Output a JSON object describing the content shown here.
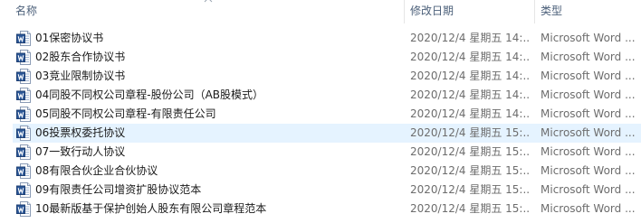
{
  "columns": {
    "name": "名称",
    "date": "修改日期",
    "type": "类型"
  },
  "icon": "word-document-icon",
  "accent": "#2b5797",
  "selected_index": 5,
  "rows": [
    {
      "name": "01保密协议书",
      "date": "2020/12/4 星期五 14:...",
      "type": "Microsoft Word ..."
    },
    {
      "name": "02股东合作协议书",
      "date": "2020/12/4 星期五 14:...",
      "type": "Microsoft Word ..."
    },
    {
      "name": "03竞业限制协议书",
      "date": "2020/12/4 星期五 14:...",
      "type": "Microsoft Word ..."
    },
    {
      "name": "04同股不同权公司章程-股份公司（AB股模式）",
      "date": "2020/12/4 星期五 14:...",
      "type": "Microsoft Word ..."
    },
    {
      "name": "05同股不同权公司章程-有限责任公司",
      "date": "2020/12/4 星期五 14:...",
      "type": "Microsoft Word ..."
    },
    {
      "name": "06投票权委托协议",
      "date": "2020/12/4 星期五 15:...",
      "type": "Microsoft Word ..."
    },
    {
      "name": "07一致行动人协议",
      "date": "2020/12/4 星期五 15:...",
      "type": "Microsoft Word ..."
    },
    {
      "name": "08有限合伙企业合伙协议",
      "date": "2020/12/4 星期五 15:...",
      "type": "Microsoft Word ..."
    },
    {
      "name": "09有限责任公司增资扩股协议范本",
      "date": "2020/12/4 星期五 15:...",
      "type": "Microsoft Word ..."
    },
    {
      "name": "10最新版基于保护创始人股东有限公司章程范本",
      "date": "2020/12/4 星期五 15:...",
      "type": "Microsoft Word ..."
    }
  ]
}
